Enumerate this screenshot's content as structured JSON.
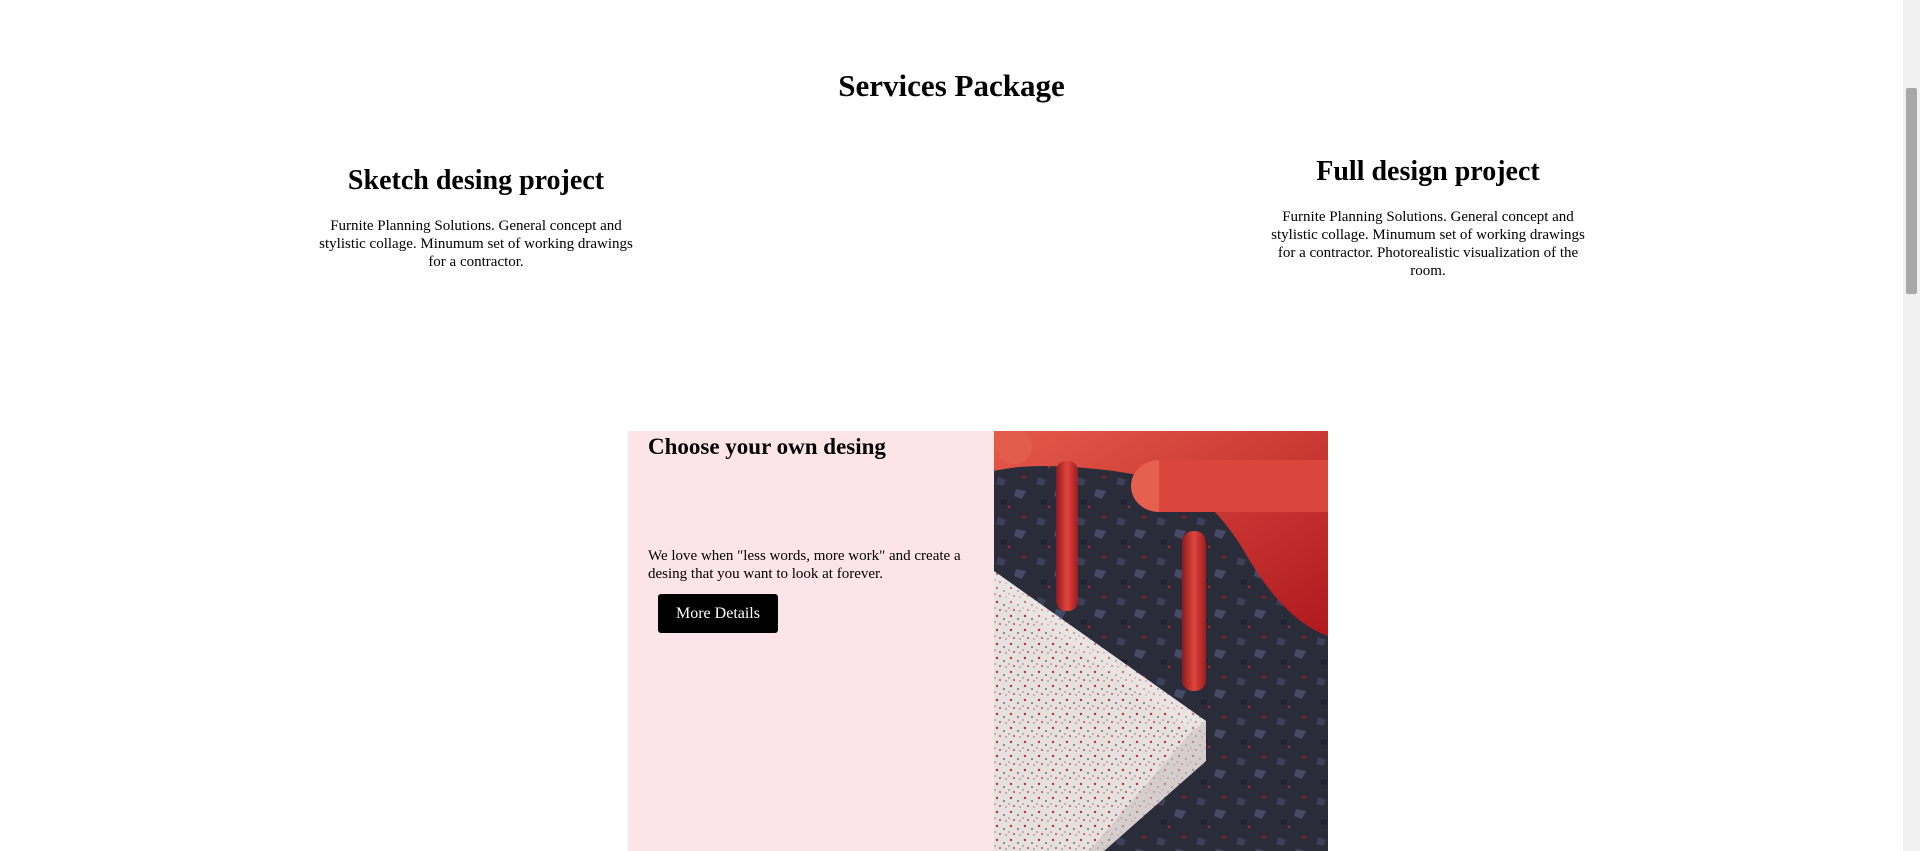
{
  "section": {
    "title": "Services Package"
  },
  "packages": [
    {
      "title": "Sketch desing project",
      "description": "Furnite Planning Solutions. General concept and stylistic collage. Minumum set of working drawings for a contractor."
    },
    {
      "title": "Full design project",
      "description": "Furnite Planning Solutions. General concept and stylistic collage. Minumum set of working drawings for a contractor. Photorealistic visualization of the room."
    }
  ],
  "feature": {
    "title": "Choose your own desing",
    "description": "We love when \"less words, more work\" and create a desing that you want to look at forever.",
    "button_label": "More Details"
  },
  "colors": {
    "feature_background": "#fde4e8",
    "button_background": "#000000",
    "accent_red": "#d9322e"
  }
}
